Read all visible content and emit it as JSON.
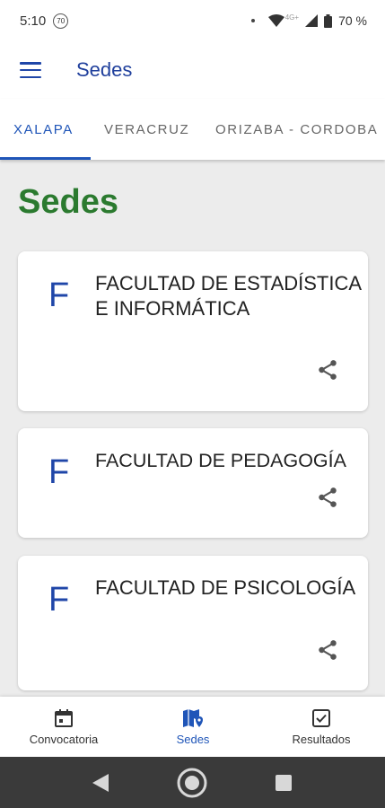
{
  "status_bar": {
    "time": "5:10",
    "notification_badge": "70",
    "network_label": "4G+",
    "battery": "70 %"
  },
  "app_bar": {
    "title": "Sedes",
    "menu_icon": "hamburger-menu-icon"
  },
  "tabs": [
    {
      "label": "XALAPA",
      "active": true
    },
    {
      "label": "VERACRUZ",
      "active": false
    },
    {
      "label": "ORIZABA - CORDOBA",
      "active": false
    }
  ],
  "page": {
    "heading": "Sedes"
  },
  "cards": [
    {
      "letter": "F",
      "title": "FACULTAD DE ESTADÍSTICA E INFORMÁTICA",
      "icon": "share-icon"
    },
    {
      "letter": "F",
      "title": "FACULTAD DE PEDAGOGÍA",
      "icon": "share-icon"
    },
    {
      "letter": "F",
      "title": "FACULTAD DE PSICOLOGÍA",
      "icon": "share-icon"
    }
  ],
  "bottom_nav": [
    {
      "label": "Convocatoria",
      "icon": "calendar-icon",
      "active": false
    },
    {
      "label": "Sedes",
      "icon": "map-icon",
      "active": true
    },
    {
      "label": "Resultados",
      "icon": "checkbox-icon",
      "active": false
    }
  ],
  "colors": {
    "primary": "#1f55b8",
    "heading_green": "#2b7a2f",
    "background": "#ececec",
    "system_nav": "#3a3a3a"
  }
}
